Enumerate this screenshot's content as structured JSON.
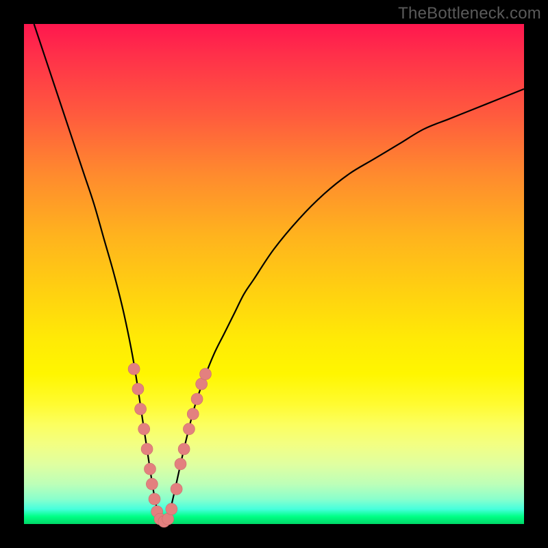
{
  "watermark": "TheBottleneck.com",
  "colors": {
    "curve_stroke": "#000000",
    "marker_fill": "#e3807f",
    "marker_stroke": "#c96d6c",
    "frame": "#000000"
  },
  "chart_data": {
    "type": "line",
    "title": "",
    "xlabel": "",
    "ylabel": "",
    "xlim": [
      0,
      100
    ],
    "ylim": [
      0,
      100
    ],
    "grid": false,
    "legend": false,
    "series": [
      {
        "name": "bottleneck-curve",
        "x": [
          2,
          4,
          6,
          8,
          10,
          12,
          14,
          16,
          18,
          20,
          22,
          24,
          26,
          27,
          28,
          29,
          30,
          32,
          34,
          36,
          38,
          40,
          42,
          44,
          46,
          50,
          55,
          60,
          65,
          70,
          75,
          80,
          85,
          90,
          95,
          100
        ],
        "y": [
          100,
          94,
          88,
          82,
          76,
          70,
          64,
          57,
          50,
          42,
          32,
          19,
          6,
          2,
          0,
          2,
          6,
          15,
          23,
          29,
          34,
          38,
          42,
          46,
          49,
          55,
          61,
          66,
          70,
          73,
          76,
          79,
          81,
          83,
          85,
          87
        ]
      }
    ],
    "markers": {
      "name": "highlighted-points",
      "points": [
        {
          "x": 22.0,
          "y": 31
        },
        {
          "x": 22.8,
          "y": 27
        },
        {
          "x": 23.3,
          "y": 23
        },
        {
          "x": 24.0,
          "y": 19
        },
        {
          "x": 24.6,
          "y": 15
        },
        {
          "x": 25.2,
          "y": 11
        },
        {
          "x": 25.6,
          "y": 8
        },
        {
          "x": 26.1,
          "y": 5
        },
        {
          "x": 26.6,
          "y": 2.5
        },
        {
          "x": 27.2,
          "y": 1
        },
        {
          "x": 28.0,
          "y": 0.5
        },
        {
          "x": 28.8,
          "y": 1
        },
        {
          "x": 29.5,
          "y": 3
        },
        {
          "x": 30.5,
          "y": 7
        },
        {
          "x": 31.3,
          "y": 12
        },
        {
          "x": 32.0,
          "y": 15
        },
        {
          "x": 33.0,
          "y": 19
        },
        {
          "x": 33.8,
          "y": 22
        },
        {
          "x": 34.6,
          "y": 25
        },
        {
          "x": 35.5,
          "y": 28
        },
        {
          "x": 36.3,
          "y": 30
        }
      ]
    }
  }
}
